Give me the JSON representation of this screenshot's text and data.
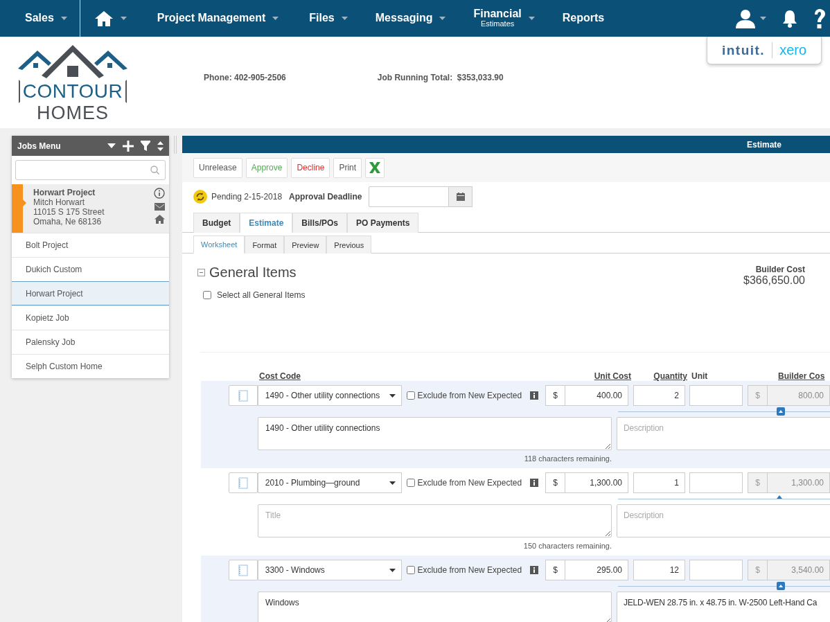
{
  "nav": {
    "items": [
      {
        "kind": "text",
        "label": "Sales",
        "dropdown": true
      },
      {
        "kind": "home",
        "dropdown": true
      },
      {
        "kind": "text",
        "label": "Project Management",
        "dropdown": true
      },
      {
        "kind": "text",
        "label": "Files",
        "dropdown": true
      },
      {
        "kind": "text",
        "label": "Messaging",
        "dropdown": true
      },
      {
        "kind": "text",
        "label": "Financial",
        "sublabel": "Estimates",
        "dropdown": true
      },
      {
        "kind": "text",
        "label": "Reports",
        "dropdown": false
      }
    ],
    "right": [
      {
        "kind": "user",
        "dropdown": true
      },
      {
        "kind": "bell",
        "dropdown": false
      },
      {
        "kind": "help",
        "dropdown": false
      }
    ]
  },
  "header": {
    "company": [
      "CONTOUR",
      "HOMES"
    ],
    "phone": "Phone: 402-905-2506",
    "running_total_label": "Job Running Total:",
    "running_total": "$353,033.90",
    "integrations": [
      "intuit.",
      "xero"
    ]
  },
  "jobs_menu": {
    "title": "Jobs Menu",
    "active_job": {
      "name": "Horwart Project",
      "contact": "Mitch Horwart",
      "address": [
        "11015 S 175 Street",
        "Omaha, Ne 68136"
      ]
    },
    "jobs": [
      {
        "name": "Bolt Project",
        "selected": false
      },
      {
        "name": "Dukich Custom",
        "selected": false
      },
      {
        "name": "Horwart Project",
        "selected": true
      },
      {
        "name": "Kopietz Job",
        "selected": false
      },
      {
        "name": "Palensky Job",
        "selected": false
      },
      {
        "name": "Selph Custom Home",
        "selected": false
      }
    ]
  },
  "estimate": {
    "title": "Estimate",
    "actions": [
      {
        "label": "Unrelease",
        "kind": "neutral"
      },
      {
        "label": "Approve",
        "kind": "approve"
      },
      {
        "label": "Decline",
        "kind": "decline"
      },
      {
        "label": "Print",
        "kind": "neutral"
      }
    ],
    "status": "Pending 2-15-2018",
    "deadline_label": "Approval Deadline",
    "tabs": [
      {
        "label": "Budget",
        "selected": false
      },
      {
        "label": "Estimate",
        "selected": true
      },
      {
        "label": "Bills/POs",
        "selected": false
      },
      {
        "label": "PO Payments",
        "selected": false
      }
    ],
    "subtabs": [
      {
        "label": "Worksheet",
        "selected": true
      },
      {
        "label": "Format",
        "selected": false
      },
      {
        "label": "Preview",
        "selected": false
      },
      {
        "label": "Previous",
        "selected": false
      }
    ],
    "section": {
      "title": "General Items",
      "expanded": true,
      "select_all_label": "Select all General Items",
      "select_all_checked": false,
      "builder_cost_label": "Builder Cost",
      "builder_cost": "$366,650.00"
    },
    "columns": {
      "cost_code": "Cost Code",
      "unit_cost": "Unit Cost",
      "quantity": "Quantity",
      "unit": "Unit",
      "builder_cost": "Builder Cos"
    },
    "items": [
      {
        "cost_code": "1490 - Other utility connections",
        "exclude_label": "Exclude from New Expected",
        "exclude_checked": false,
        "currency": "$",
        "unit_cost": "400.00",
        "quantity": "2",
        "builder_currency": "$",
        "builder_cost": "800.00",
        "highlighted": true,
        "title": {
          "value": "1490 - Other utility connections"
        },
        "description": {
          "placeholder": "Description"
        },
        "remaining": "118 characters remaining."
      },
      {
        "cost_code": "2010 - Plumbing—ground",
        "exclude_label": "Exclude from New Expected",
        "exclude_checked": false,
        "currency": "$",
        "unit_cost": "1,300.00",
        "quantity": "1",
        "builder_currency": "$",
        "builder_cost": "1,300.00",
        "highlighted": false,
        "title": {
          "placeholder": "Title"
        },
        "description": {
          "placeholder": "Description"
        },
        "remaining": "150 characters remaining."
      },
      {
        "cost_code": "3300 - Windows",
        "exclude_label": "Exclude from New Expected",
        "exclude_checked": false,
        "currency": "$",
        "unit_cost": "295.00",
        "quantity": "12",
        "builder_currency": "$",
        "builder_cost": "3,540.00",
        "highlighted": true,
        "title": {
          "value": "Windows"
        },
        "description": {
          "value": "JELD-WEN 28.75 in. x 48.75 in. W-2500 Left-Hand Ca"
        }
      }
    ]
  }
}
